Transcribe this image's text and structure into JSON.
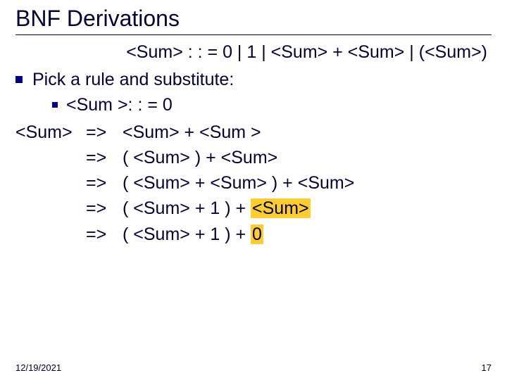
{
  "title": "BNF Derivations",
  "grammar": "<Sum> : : = 0 | 1 | <Sum> + <Sum> | (<Sum>)",
  "bullet1": "Pick a rule and substitute:",
  "sub1": "<Sum >: : = 0",
  "deriv": {
    "lhs": "<Sum>",
    "arrow": "=>",
    "rows": [
      "<Sum> + <Sum >",
      "( <Sum> ) + <Sum>",
      "( <Sum> + <Sum> ) + <Sum>",
      "( <Sum> + 1 ) + ",
      "( <Sum> + 1 ) + "
    ],
    "hl4": "<Sum>",
    "hl5": "0"
  },
  "footer": {
    "date": "12/19/2021",
    "page": "17"
  }
}
